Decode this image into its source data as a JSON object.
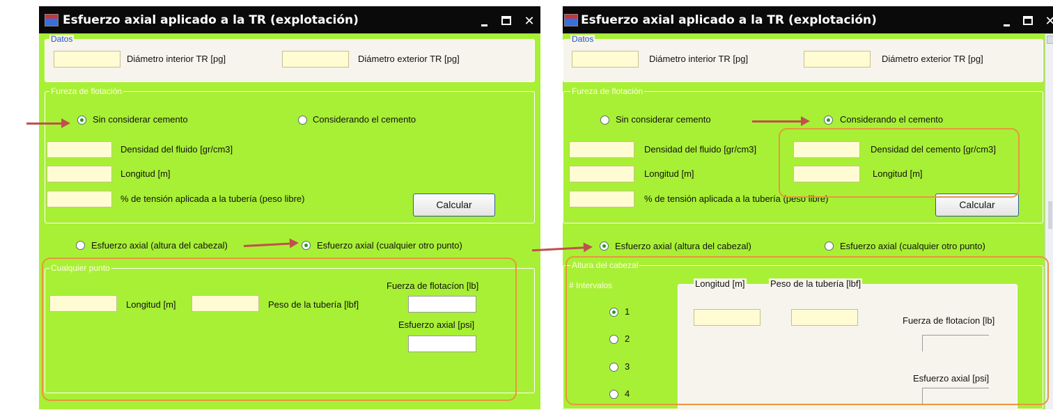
{
  "window_title": "Esfuerzo axial aplicado a la TR (explotación)",
  "window_controls": {
    "close": "✕"
  },
  "datos": {
    "legend": "Datos",
    "diam_int": "Diámetro interior TR [pg]",
    "diam_ext": "Diámetro exterior TR [pg]"
  },
  "flotacion": {
    "legend": "Fureza de flotación",
    "radio_sin": "Sin considerar cemento",
    "radio_con": "Considerando el cemento",
    "densidad_fluido": "Densidad del fluido [gr/cm3]",
    "longitud": "Longitud [m]",
    "tension": "% de tensión aplicada a la tubería (peso libre)",
    "densidad_cemento": "Densidad del cemento [gr/cm3]",
    "calcular": "Calcular"
  },
  "esfuerzo": {
    "radio_cabezal": "Esfuerzo axial (altura del cabezal)",
    "radio_otro": "Esfuerzo axial (cualquier otro punto)"
  },
  "cualquier_punto": {
    "legend": "Cualquier punto",
    "longitud": "Longitud [m]",
    "peso": "Peso de la tubería [lbf]",
    "fuerza_flotacion": "Fuerza de flotacíon [lb]",
    "esfuerzo_axial": "Esfuerzo axial [psi]"
  },
  "altura_cabezal": {
    "legend": "Altura del cabezal",
    "intervalos_legend": "# Intervalos",
    "intervalos": [
      "1",
      "2",
      "3",
      "4"
    ],
    "longitud_header": "Longitud [m]",
    "peso_header": "Peso de la tubería [lbf]",
    "fuerza_flotacion": "Fuerza de flotacíon [lb]",
    "esfuerzo_axial": "Esfuerzo axial [psi]"
  },
  "state": {
    "left": {
      "flotacion": "sin_considerar_cemento",
      "esfuerzo": "cualquier_otro_punto"
    },
    "right": {
      "flotacion": "considerando_el_cemento",
      "esfuerzo": "altura_del_cabezal",
      "intervalos": "1"
    }
  },
  "colors": {
    "form_bg": "#a8f035",
    "titlebar": "#0a0a0a",
    "highlight": "#e8963c",
    "arrow": "#c0504d",
    "input_bg": "#fffbd2"
  }
}
